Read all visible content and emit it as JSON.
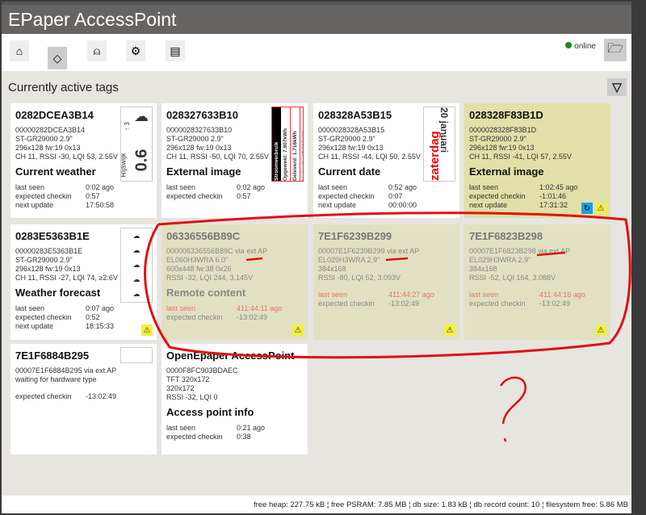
{
  "app": {
    "title": "EPaper AccessPoint",
    "status": "online"
  },
  "nav": [
    "home-icon",
    "tag-icon",
    "antenna-icon",
    "gear-icon",
    "document-icon"
  ],
  "section": {
    "title": "Currently active tags"
  },
  "tags": [
    {
      "mac": "0282DCEA3B14",
      "lines": [
        "00000282DCEA3B14",
        "ST-GR29000 2.9\"",
        "296x128 fw:19 0x13",
        "CH 11, RSSI -30, LQI 53, 2.55V"
      ],
      "content": "Current weather",
      "rows": [
        [
          "last seen",
          "0:02 ago"
        ],
        [
          "expected checkin",
          "0:57"
        ],
        [
          "next update",
          "17:50:58"
        ]
      ],
      "thumb": {
        "city": "Rijswijk",
        "temp": "0.6",
        "wind": "↑ 3"
      }
    },
    {
      "mac": "028327633B10",
      "lines": [
        "0000028327633B10",
        "ST-GR29000 2.9\"",
        "296x128 fw:19 0x13",
        "CH 11, RSSI -50, LQI 70, 2.55V"
      ],
      "content": "External image",
      "rows": [
        [
          "last seen",
          "0:02 ago"
        ],
        [
          "expected checkin",
          "0:57"
        ]
      ],
      "thumb": {
        "l1": "Stroomverbruik",
        "l2": "Opgewekt: 7.807kWh",
        "l3": "Geleverd: 1.716kWh",
        "l4": "Verbruik: 15.239kWh"
      }
    },
    {
      "mac": "028328A53B15",
      "lines": [
        "0000028328A53B15",
        "ST-GR29000 2.9\"",
        "296x128 fw:19 0x13",
        "CH 11, RSSI -44, LQI 50, 2.55V"
      ],
      "content": "Current date",
      "rows": [
        [
          "last seen",
          "0:52 ago"
        ],
        [
          "expected checkin",
          "0:07"
        ],
        [
          "next update",
          "00:00:00"
        ]
      ],
      "thumb": {
        "day": "zaterdag",
        "date": "20 januari"
      }
    },
    {
      "mac": "028328F83B1D",
      "lines": [
        "0000028328F83B1D",
        "ST-GR29000 2.9\"",
        "296x128 fw:19 0x13",
        "CH 11, RSSI -41, LQI 57, 2.55V"
      ],
      "content": "External image",
      "rows": [
        [
          "last seen",
          "1:02:45 ago"
        ],
        [
          "expected checkin",
          "-1:01:46"
        ],
        [
          "next update",
          "17:31:32"
        ]
      ]
    },
    {
      "mac": "0283E5363B1E",
      "lines": [
        "00000283E5363B1E",
        "ST-GR29000 2.9\"",
        "296x128 fw:19 0x13",
        "CH 11, RSSI -27, LQI 74, ≥2.6V"
      ],
      "content": "Weather forecast",
      "rows": [
        [
          "last seen",
          "0:07 ago"
        ],
        [
          "expected checkin",
          "0:52"
        ],
        [
          "next update",
          "18:15:33"
        ]
      ]
    },
    {
      "mac": "06336556B89C",
      "lines": [
        "000006336556B89C via ext AP",
        "EL060H3WRA 6.0\"",
        "600x448 fw:38 0x26",
        "RSSI -32, LQI 244, 3.145V"
      ],
      "content": "Remote content",
      "rows": [
        [
          "last seen",
          "411:44:11 ago"
        ],
        [
          "expected checkin",
          "-13:02:49"
        ]
      ]
    },
    {
      "mac": "7E1F6239B299",
      "lines": [
        "00007E1F6239B299 via ext AP",
        "EL029H3WRA 2.9\"",
        "384x168",
        "RSSI -80, LQI 52, 3.093V"
      ],
      "content": "",
      "rows": [
        [
          "last seen",
          "411:44:27 ago"
        ],
        [
          "expected checkin",
          "-13:02:49"
        ]
      ]
    },
    {
      "mac": "7E1F6823B298",
      "lines": [
        "00007E1F6823B298 via ext AP",
        "EL029H3WRA 2.9\"",
        "384x168",
        "RSSI -52, LQI 164, 3.088V"
      ],
      "content": "",
      "rows": [
        [
          "last seen",
          "411:44:16 ago"
        ],
        [
          "expected checkin",
          "-13:02:49"
        ]
      ]
    },
    {
      "mac": "7E1F6884B295",
      "lines": [
        "00007E1F6884B295 via ext AP",
        "waiting for hardware type"
      ],
      "content": "",
      "rows": [
        [
          "expected checkin",
          "-13:02:49"
        ]
      ]
    },
    {
      "mac": "OpenEpaper AccessPoint",
      "lines": [
        "0000F8FC903BDAEC",
        "TFT 320x172",
        "320x172",
        "RSSI -32, LQI 0"
      ],
      "content": "Access point info",
      "rows": [
        [
          "last seen",
          "0:21 ago"
        ],
        [
          "expected checkin",
          "0:38"
        ]
      ]
    }
  ],
  "footer": "free heap: 227.75 kB ¦ free PSRAM: 7.85 MB ¦ db size: 1.83 kB ¦ db record count: 10 ¦ filesystem free: 5.86 MB"
}
